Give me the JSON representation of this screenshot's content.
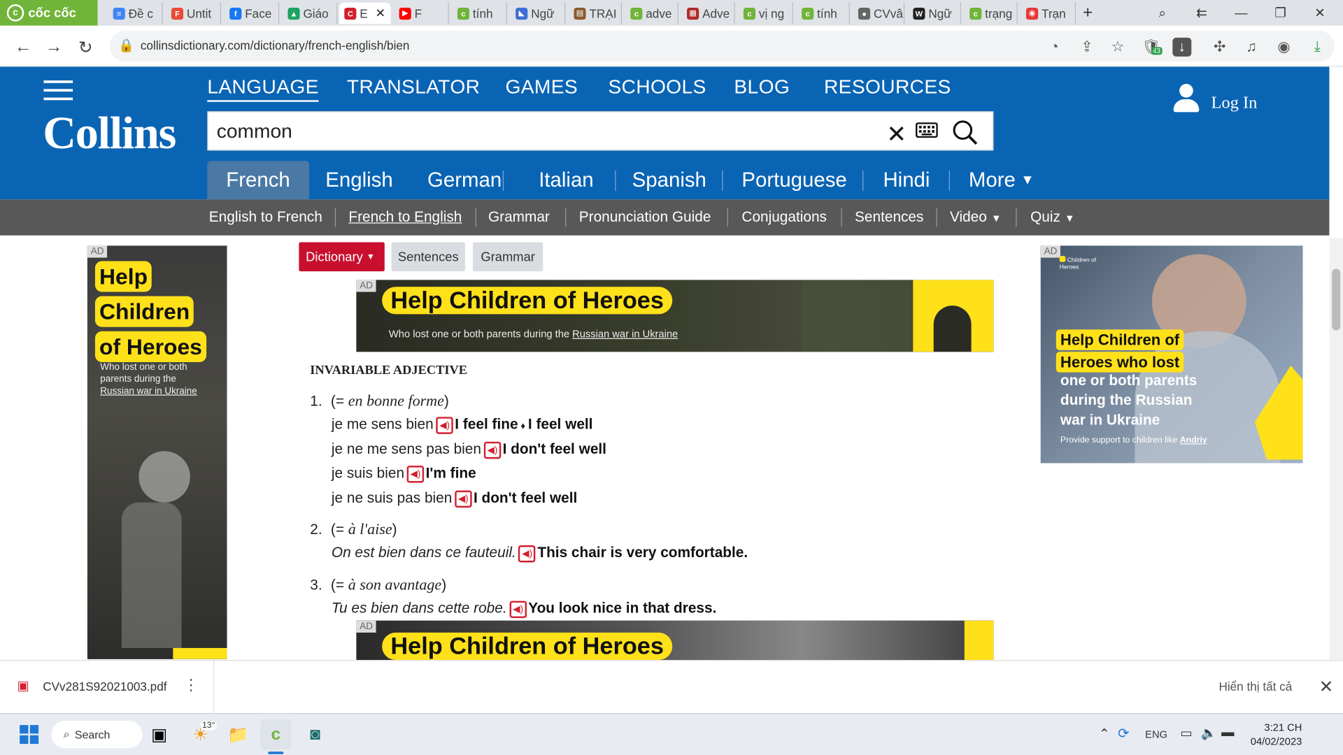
{
  "browser": {
    "brand": "cốc cốc",
    "tabs": [
      {
        "label": "Đề c",
        "color": "#4285f4",
        "glyph": "≡"
      },
      {
        "label": "Untit",
        "color": "#e94b35",
        "glyph": "F"
      },
      {
        "label": "Face",
        "color": "#1877f2",
        "glyph": "f"
      },
      {
        "label": "Giáo",
        "color": "#1ea362",
        "glyph": "▲"
      },
      {
        "label": "E",
        "color": "#d3202f",
        "glyph": "C",
        "active": true
      },
      {
        "label": "F",
        "color": "#ff0000",
        "glyph": "▶"
      },
      {
        "label": "tính",
        "color": "#71b43a",
        "glyph": "c"
      },
      {
        "label": "Ngữ",
        "color": "#3b6fd4",
        "glyph": "◣"
      },
      {
        "label": "TRẠI",
        "color": "#8a5b2e",
        "glyph": "▤"
      },
      {
        "label": "adve",
        "color": "#71b43a",
        "glyph": "c"
      },
      {
        "label": "Adve",
        "color": "#b02a2a",
        "glyph": "▦"
      },
      {
        "label": "vị ng",
        "color": "#71b43a",
        "glyph": "c"
      },
      {
        "label": "tính",
        "color": "#71b43a",
        "glyph": "c"
      },
      {
        "label": "CVvâ",
        "color": "#666666",
        "glyph": "●"
      },
      {
        "label": "Ngữ",
        "color": "#222222",
        "glyph": "W"
      },
      {
        "label": "trạng",
        "color": "#71b43a",
        "glyph": "c"
      },
      {
        "label": "Trạn",
        "color": "#e53935",
        "glyph": "◉"
      }
    ],
    "url": "collinsdictionary.com/dictionary/french-english/bien",
    "extension_badge": "43"
  },
  "site": {
    "logo": "Collins",
    "topnav": [
      "LANGUAGE",
      "TRANSLATOR",
      "GAMES",
      "SCHOOLS",
      "BLOG",
      "RESOURCES"
    ],
    "search_value": "common",
    "login": "Log In",
    "languages": [
      "French",
      "English",
      "German",
      "Italian",
      "Spanish",
      "Portuguese",
      "Hindi",
      "More"
    ],
    "subnav": [
      "English to French",
      "French to English",
      "Grammar",
      "Pronunciation Guide",
      "Conjugations",
      "Sentences",
      "Video",
      "Quiz"
    ]
  },
  "content": {
    "pills": [
      "Dictionary",
      "Sentences",
      "Grammar"
    ],
    "pos": "INVARIABLE ADJECTIVE",
    "senses": [
      {
        "num": "1.",
        "gloss_open": "(= ",
        "gloss": "en bonne forme",
        "gloss_close": ")",
        "examples": [
          {
            "fr": "je me sens bien",
            "en_parts": [
              "I feel fine",
              "I feel well"
            ]
          },
          {
            "fr": "je ne me sens pas bien",
            "en": "I don't feel well"
          },
          {
            "fr": "je suis bien",
            "en": "I'm fine"
          },
          {
            "fr": "je ne suis pas bien",
            "en": "I don't feel well"
          }
        ]
      },
      {
        "num": "2.",
        "gloss_open": "(= ",
        "gloss": "à l'aise",
        "gloss_close": ")",
        "examples": [
          {
            "fr": "On est bien dans ce fauteuil.",
            "en": "This chair is very comfortable."
          }
        ]
      },
      {
        "num": "3.",
        "gloss_open": "(= ",
        "gloss": "à son avantage",
        "gloss_close": ")",
        "examples": [
          {
            "fr": "Tu es bien dans cette robe.",
            "en": "You look nice in that dress."
          }
        ]
      }
    ]
  },
  "ads": {
    "tag": "AD",
    "left": {
      "headline_lines": [
        "Help",
        "Children",
        "of Heroes"
      ],
      "body_lines": [
        "Who lost one or both",
        "parents during the"
      ],
      "body_link": "Russian war in Ukraine"
    },
    "banner_top": {
      "headline": "Help Children of Heroes",
      "sub_prefix": "Who lost one or both parents during the ",
      "sub_link": "Russian war in Ukraine"
    },
    "right": {
      "logo_text": "Children of Heroes",
      "headline_lines": [
        "Help Children of",
        "Heroes who lost"
      ],
      "body_lines": [
        "one or both parents",
        "during the Russian",
        "war in Ukraine"
      ],
      "footer_prefix": "Provide support to children like ",
      "footer_name": "Andriy"
    },
    "banner_bottom": {
      "headline": "Help Children of Heroes"
    }
  },
  "downloads": {
    "file": "CVv281S92021003.pdf",
    "show_all": "Hiển thị tất cả"
  },
  "taskbar": {
    "search": "Search",
    "weather": "13°",
    "lang": "ENG",
    "time": "3:21 CH",
    "date": "04/02/2023"
  },
  "colors": {
    "collins_blue": "#0a64b4",
    "subnav_gray": "#585858",
    "collins_red": "#c8102e",
    "ad_yellow": "#ffe11a",
    "coccoc_green": "#71b43a"
  }
}
